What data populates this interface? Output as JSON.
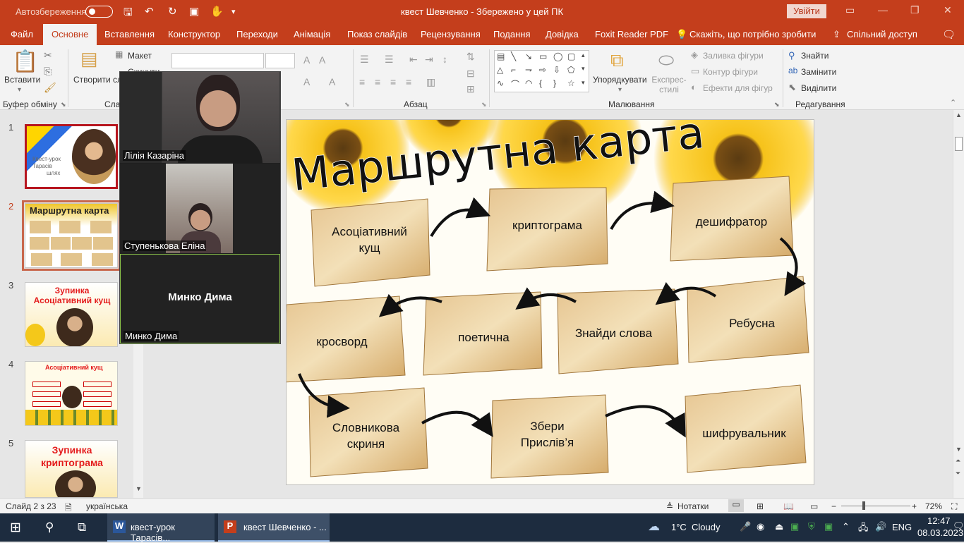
{
  "titlebar": {
    "autosave_label": "Автозбереження",
    "doc_title": "квест Шевченко  -  Збережено у цей ПК",
    "signin_label": "Увійти",
    "accent": "#c43e1c"
  },
  "tabs": [
    "Файл",
    "Основне",
    "Вставлення",
    "Конструктор",
    "Переходи",
    "Анімація",
    "Показ слайдів",
    "Рецензування",
    "Подання",
    "Довідка",
    "Foxit Reader PDF",
    "Скажіть, що потрібно зробити"
  ],
  "share_label": "Спільний доступ",
  "ribbon": {
    "paste": "Вставити",
    "new_slide": "Створити слайд",
    "layout": "Макет",
    "reset": "Скинути",
    "clipboard_group": "Буфер обміну",
    "slides_group": "Сла",
    "paragraph_group": "Абзац",
    "drawing_group": "Малювання",
    "editing_group": "Редагування",
    "arrange": "Упорядкувати",
    "quick_styles": "Експрес-стилі",
    "shape_fill": "Заливка фігури",
    "shape_outline": "Контур фігури",
    "shape_effects": "Ефекти для фігур",
    "find": "Знайти",
    "replace": "Замінити",
    "select": "Виділити"
  },
  "thumbnails": [
    {
      "num": "1",
      "lines": [
        "Квест-урок",
        "Тарасів",
        "шлях"
      ]
    },
    {
      "num": "2",
      "lines": [
        "Маршрутна карта"
      ]
    },
    {
      "num": "3",
      "lines": [
        "Зупинка",
        "Асоціативний кущ"
      ]
    },
    {
      "num": "4",
      "lines": [
        "Асоціативний кущ"
      ]
    },
    {
      "num": "5",
      "lines": [
        "Зупинка",
        "криптограма"
      ]
    }
  ],
  "slide": {
    "title": "Маршрутна карта",
    "nodes": [
      "Асоціативний\nкущ",
      "криптограма",
      "дешифратор",
      "кросворд",
      "поетична",
      "Знайди слова",
      "Ребусна",
      "Словникова\nскриня",
      "Збери\nПрислів’я",
      "шифрувальник"
    ]
  },
  "video": {
    "participants": [
      {
        "name": "Лілія Казаріна"
      },
      {
        "name": "Ступенькова Еліна"
      },
      {
        "name": "Минко Дима",
        "center_label": "Минко Дима"
      }
    ]
  },
  "status": {
    "slide_counter": "Слайд 2 з 23",
    "language": "українська",
    "notes": "Нотатки",
    "zoom": "72%"
  },
  "taskbar": {
    "app1": "квест-урок Тарасів...",
    "app2": "квест Шевченко - ...",
    "temperature": "1°C",
    "weather": "Cloudy",
    "lang": "ENG",
    "time": "12:47",
    "date": "08.03.2023"
  }
}
